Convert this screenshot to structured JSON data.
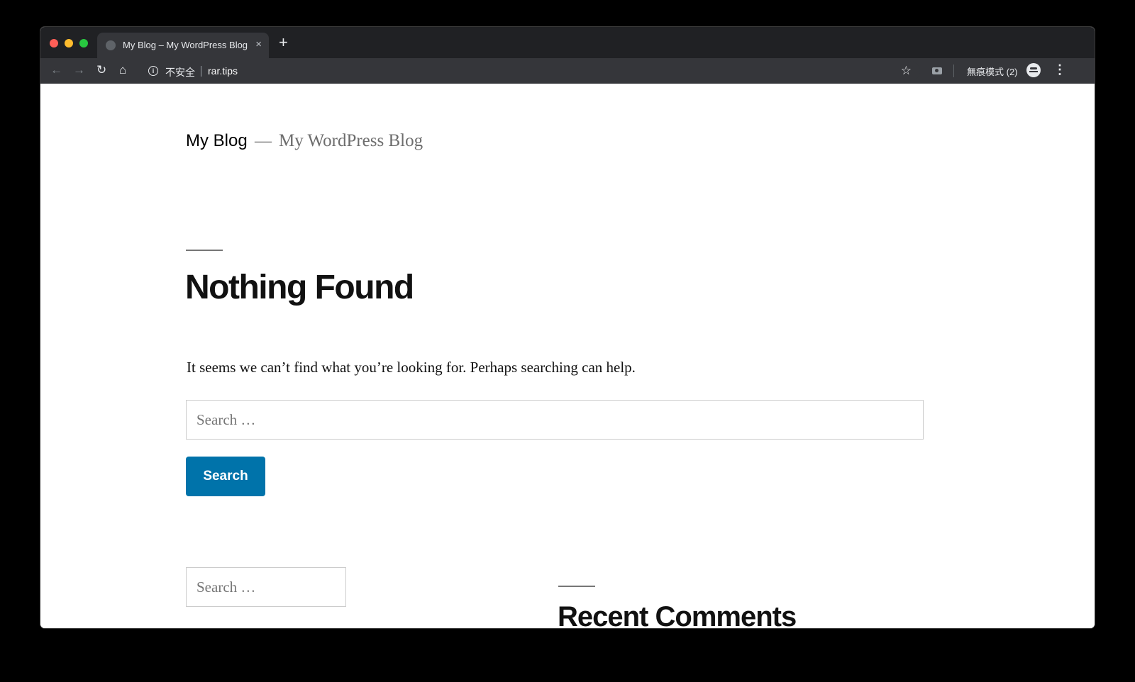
{
  "browser": {
    "tab": {
      "title": "My Blog – My WordPress Blog",
      "close_glyph": "×"
    },
    "new_tab_glyph": "+",
    "toolbar": {
      "back_icon": "←",
      "forward_icon": "→",
      "reload_icon": "↻",
      "home_icon": "⌂",
      "security_label": "不安全",
      "url": "rar.tips",
      "star_icon": "☆",
      "incognito_label": "無痕模式 (2)",
      "menu_icon": "⋮"
    }
  },
  "site": {
    "title": "My Blog",
    "separator": "—",
    "description": "My WordPress Blog"
  },
  "content": {
    "page_title": "Nothing Found",
    "message": "It seems we can’t find what you’re looking for. Perhaps searching can help.",
    "search": {
      "placeholder": "Search …",
      "button_label": "Search"
    }
  },
  "widgets": {
    "search_placeholder": "Search …",
    "recent_comments_heading": "Recent Comments"
  },
  "colors": {
    "accent": "#0073aa",
    "chrome_dark": "#202124",
    "chrome_toolbar": "#35363a"
  }
}
